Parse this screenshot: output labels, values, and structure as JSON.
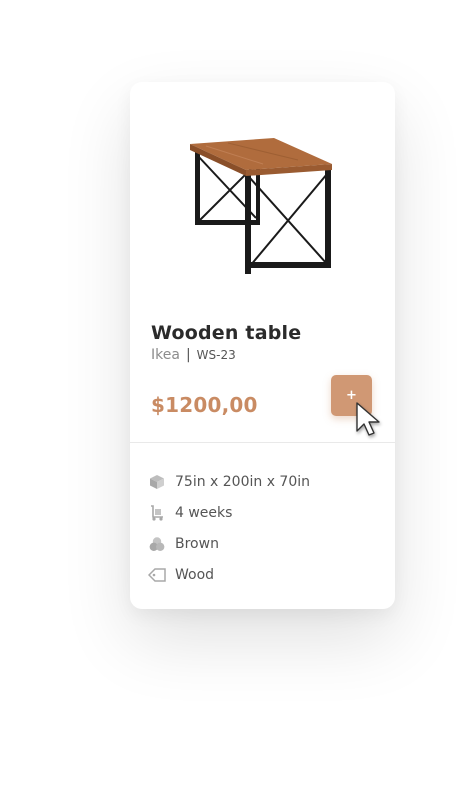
{
  "product": {
    "name": "Wooden table",
    "brand": "Ikea",
    "separator": "|",
    "sku": "WS-23",
    "price": "$1200,00",
    "add_button_label": "+"
  },
  "specs": [
    {
      "icon": "box-icon",
      "text": "75in x 200in x 70in"
    },
    {
      "icon": "delivery-cart-icon",
      "text": "4 weeks"
    },
    {
      "icon": "color-swatch-icon",
      "text": "Brown"
    },
    {
      "icon": "material-tag-icon",
      "text": "Wood"
    }
  ],
  "colors": {
    "accent": "#c98b63",
    "button": "#d09874",
    "title": "#2b2b2b",
    "muted": "#8c8c8c",
    "table_top": "#b06c3d",
    "table_frame": "#1a1a1a"
  }
}
